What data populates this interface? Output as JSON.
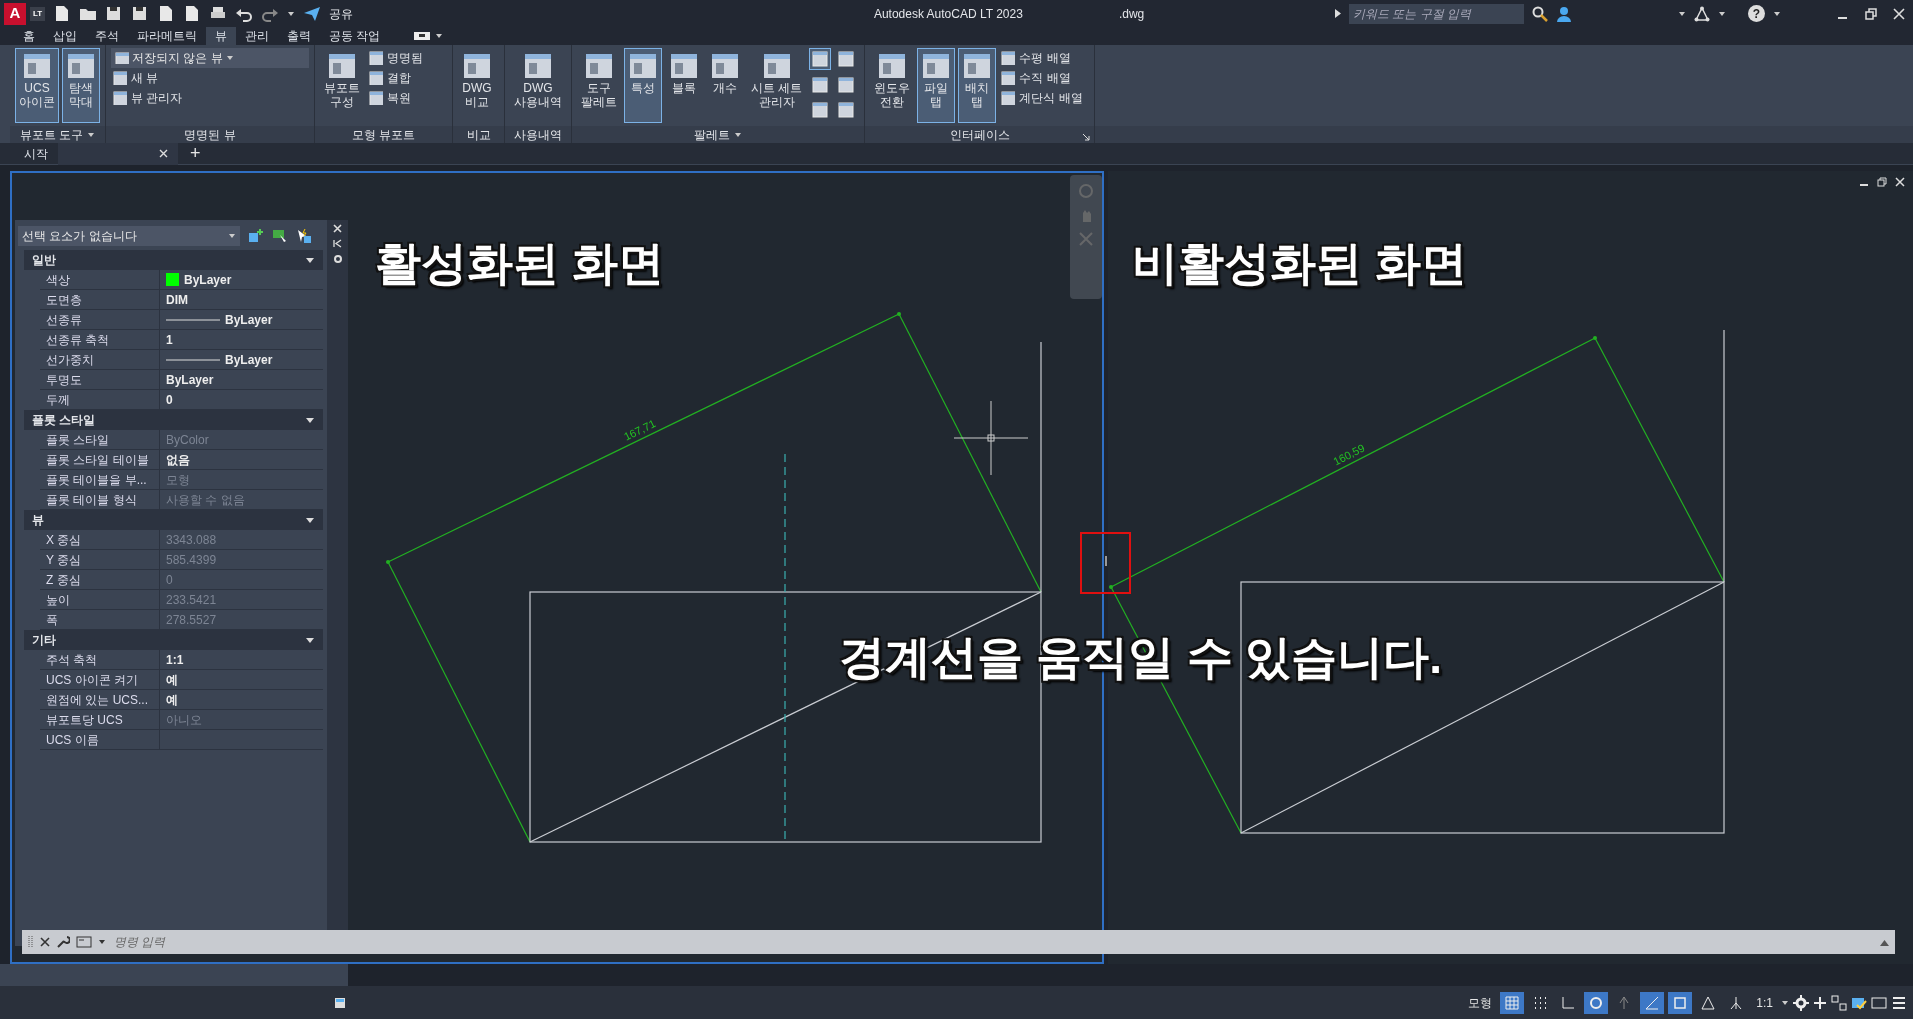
{
  "title_bar": {
    "logo": "A",
    "logo_badge": "LT",
    "share": "공유",
    "document": ".dwg",
    "title": "Autodesk AutoCAD LT 2023",
    "search": {
      "placeholder": "키워드 또는 구절 입력"
    },
    "help": "?"
  },
  "ribbon_tabs": [
    {
      "label": "홈",
      "selected": false
    },
    {
      "label": "삽입",
      "selected": false
    },
    {
      "label": "주석",
      "selected": false
    },
    {
      "label": "파라메트릭",
      "selected": false
    },
    {
      "label": "뷰",
      "selected": true
    },
    {
      "label": "관리",
      "selected": false
    },
    {
      "label": "출력",
      "selected": false
    },
    {
      "label": "공동 작업",
      "selected": false
    }
  ],
  "ribbon_panels": [
    {
      "title": "뷰포트 도구",
      "menu": true,
      "launcher": false,
      "items": [
        {
          "kind": "large",
          "label": "UCS\n아이콘",
          "selected": true
        },
        {
          "kind": "large",
          "label": "탐색\n막대",
          "selected": true
        }
      ]
    },
    {
      "title": "명명된 뷰",
      "menu": false,
      "launcher": false,
      "items": [
        {
          "kind": "dropdown",
          "label": "저장되지 않은 뷰",
          "selected": false
        },
        {
          "kind": "small",
          "label": "새 뷰",
          "selected": false
        },
        {
          "kind": "small",
          "label": "뷰 관리자",
          "selected": false
        }
      ]
    },
    {
      "title": "모형 뷰포트",
      "menu": false,
      "launcher": false,
      "items": [
        {
          "kind": "large",
          "label": "뷰포트\n구성",
          "selected": false
        },
        {
          "kind": "small",
          "label": "명명됨",
          "selected": false
        },
        {
          "kind": "small",
          "label": "결합",
          "selected": false
        },
        {
          "kind": "small",
          "label": "복원",
          "selected": false
        }
      ]
    },
    {
      "title": "비교",
      "menu": false,
      "launcher": false,
      "items": [
        {
          "kind": "large",
          "label": "DWG\n비교",
          "selected": false
        }
      ]
    },
    {
      "title": "사용내역",
      "menu": false,
      "launcher": false,
      "items": [
        {
          "kind": "large",
          "label": "DWG\n사용내역",
          "selected": false
        }
      ]
    },
    {
      "title": "팔레트",
      "menu": true,
      "launcher": false,
      "items": [
        {
          "kind": "large",
          "label": "도구\n팔레트",
          "selected": false
        },
        {
          "kind": "large",
          "label": "특성",
          "selected": true
        },
        {
          "kind": "large",
          "label": "블록",
          "selected": false
        },
        {
          "kind": "large",
          "label": "개수",
          "selected": false
        },
        {
          "kind": "large",
          "label": "시트 세트\n관리자",
          "selected": false
        },
        {
          "kind": "icon",
          "selected": true
        },
        {
          "kind": "icon",
          "selected": false
        },
        {
          "kind": "icon",
          "selected": false
        },
        {
          "kind": "icon",
          "selected": false
        },
        {
          "kind": "icon",
          "selected": false
        },
        {
          "kind": "icon",
          "selected": false
        }
      ]
    },
    {
      "title": "인터페이스",
      "menu": false,
      "launcher": true,
      "items": [
        {
          "kind": "large",
          "label": "윈도우\n전환",
          "selected": false
        },
        {
          "kind": "large",
          "label": "파일\n탭",
          "selected": true
        },
        {
          "kind": "large",
          "label": "배치\n탭",
          "selected": true
        },
        {
          "kind": "small",
          "label": "수평 배열",
          "selected": false
        },
        {
          "kind": "small",
          "label": "수직 배열",
          "selected": false
        },
        {
          "kind": "small",
          "label": "계단식 배열",
          "selected": false
        }
      ]
    }
  ],
  "document_tabs": [
    {
      "label": "시작",
      "selected": false,
      "closable": false
    },
    {
      "selected": true,
      "closable": true
    }
  ],
  "new_tab": "+",
  "viewports": [
    {
      "active": true,
      "dimension": "167,71"
    },
    {
      "active": false,
      "dimension": "160,59"
    }
  ],
  "annotations": [
    {
      "kind": "left",
      "text": "활성화된 화면"
    },
    {
      "kind": "right",
      "text": "비활성화된 화면"
    },
    {
      "kind": "center",
      "text": "경계선을 움직일 수 있습니다."
    }
  ],
  "properties": {
    "selection": "선택 요소가 없습니다",
    "sections": [
      {
        "title": "일반",
        "expanded": true,
        "rows": [
          {
            "label": "색상",
            "value": "ByLayer",
            "kind": "color",
            "color": "#00ff00",
            "disabled": false
          },
          {
            "label": "도면층",
            "value": "DIM",
            "kind": "text",
            "disabled": false
          },
          {
            "label": "선종류",
            "value": "ByLayer",
            "kind": "linetype",
            "disabled": false
          },
          {
            "label": "선종류 축척",
            "value": "1",
            "kind": "text",
            "disabled": false
          },
          {
            "label": "선가중치",
            "value": "ByLayer",
            "kind": "linetype",
            "disabled": false
          },
          {
            "label": "투명도",
            "value": "ByLayer",
            "kind": "text",
            "disabled": false
          },
          {
            "label": "두께",
            "value": "0",
            "kind": "text",
            "disabled": false
          }
        ]
      },
      {
        "title": "플롯 스타일",
        "expanded": true,
        "rows": [
          {
            "label": "플롯 스타일",
            "value": "ByColor",
            "kind": "text",
            "disabled": true
          },
          {
            "label": "플롯 스타일 테이블",
            "value": "없음",
            "kind": "text",
            "disabled": false
          },
          {
            "label": "플롯 테이블을 부...",
            "value": "모형",
            "kind": "text",
            "disabled": true
          },
          {
            "label": "플롯 테이블 형식",
            "value": "사용할 수 없음",
            "kind": "text",
            "disabled": true
          }
        ]
      },
      {
        "title": "뷰",
        "expanded": true,
        "rows": [
          {
            "label": "X 중심",
            "value": "3343.088",
            "kind": "text",
            "disabled": true
          },
          {
            "label": "Y 중심",
            "value": "585.4399",
            "kind": "text",
            "disabled": true
          },
          {
            "label": "Z 중심",
            "value": "0",
            "kind": "text",
            "disabled": true
          },
          {
            "label": "높이",
            "value": "233.5421",
            "kind": "text",
            "disabled": true
          },
          {
            "label": "폭",
            "value": "278.5527",
            "kind": "text",
            "disabled": true
          }
        ]
      },
      {
        "title": "기타",
        "expanded": true,
        "rows": [
          {
            "label": "주석 축척",
            "value": "1:1",
            "kind": "text",
            "disabled": false
          },
          {
            "label": "UCS 아이콘 켜기",
            "value": "예",
            "kind": "text",
            "disabled": false
          },
          {
            "label": "원점에 있는 UCS...",
            "value": "예",
            "kind": "text",
            "disabled": false
          },
          {
            "label": "뷰포트당 UCS",
            "value": "아니오",
            "kind": "text",
            "disabled": true
          },
          {
            "label": "UCS 이름",
            "kind": "text"
          }
        ]
      }
    ]
  },
  "command_line": {
    "placeholder": "명령 입력"
  },
  "status_bar": {
    "model": "모형",
    "toggles": [
      {
        "on": true
      },
      {
        "on": false
      },
      {
        "on": false
      },
      {
        "on": true
      },
      {
        "on": false
      },
      {
        "on": true
      },
      {
        "on": true
      },
      {
        "on": false
      },
      {
        "on": false
      }
    ],
    "scale": "1:1"
  }
}
